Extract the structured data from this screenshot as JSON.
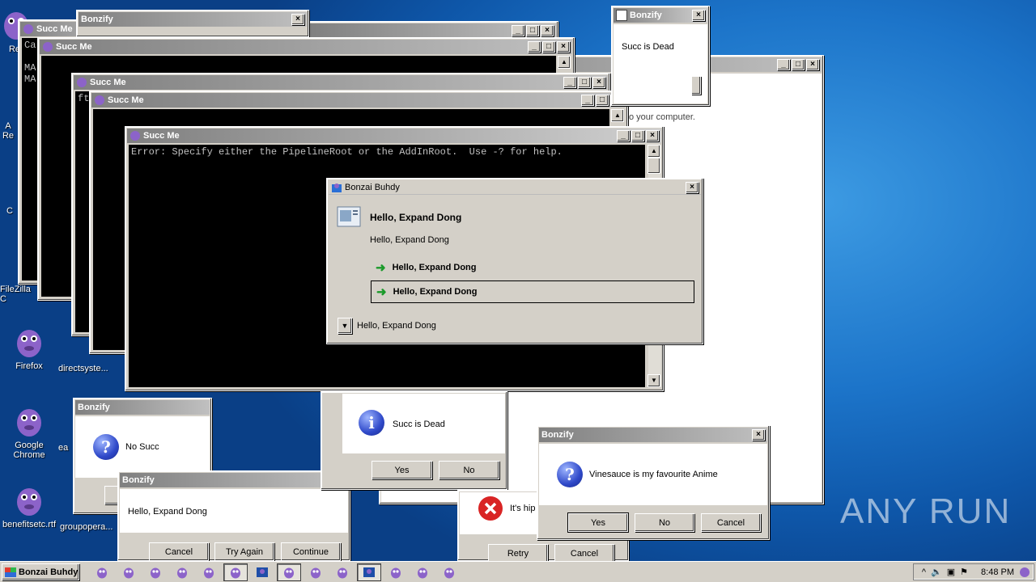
{
  "desktop_icons": [
    {
      "label": "Re",
      "name": "desktop-icon-re-1"
    },
    {
      "label": "A\nRe",
      "name": "desktop-icon-re-2"
    },
    {
      "label": "C",
      "name": "desktop-icon-c"
    },
    {
      "label": "FileZilla C",
      "name": "desktop-icon-filezilla"
    },
    {
      "label": "Firefox",
      "name": "desktop-icon-firefox"
    },
    {
      "label": "directsyste...",
      "name": "desktop-icon-directsystem"
    },
    {
      "label": "Google\nChrome",
      "name": "desktop-icon-chrome"
    },
    {
      "label": "ea",
      "name": "desktop-icon-ea"
    },
    {
      "label": "benefitsetc.rtf",
      "name": "desktop-icon-benefitsetc"
    },
    {
      "label": "groupopera...",
      "name": "desktop-icon-groupopera"
    }
  ],
  "windows": {
    "back_succ_1": {
      "title": "Succ Me",
      "text": "Ca\n\nMA\nMA"
    },
    "back_bonzify_top": {
      "title": "Bonzify"
    },
    "succ_2": {
      "title": "Succ Me"
    },
    "succ_3": {
      "title": "Succ Me",
      "text": "ft"
    },
    "succ_4": {
      "title": "Succ Me"
    },
    "succ_main": {
      "title": "Succ Me",
      "text": "Error: Specify either the PipelineRoot or the AddInRoot.  Use -? for help."
    },
    "bg_installer": {
      "partial_text": "o your computer."
    },
    "bonzify_dead_top": {
      "title": "Bonzify",
      "message": "Succ is Dead"
    },
    "bonzai_dialog": {
      "title": "Bonzai Buhdy",
      "heading": "Hello, Expand Dong",
      "subtext": "Hello, Expand Dong",
      "option1": "Hello, Expand Dong",
      "option2": "Hello, Expand Dong",
      "details": "Hello, Expand Dong"
    },
    "bonzify_nosucc": {
      "title": "Bonzify",
      "message": "No Succ"
    },
    "bonzify_hello": {
      "title": "Bonzify",
      "message": "Hello, Expand Dong",
      "buttons": [
        "Cancel",
        "Try Again",
        "Continue"
      ]
    },
    "info_dead": {
      "message": "Succ is Dead",
      "buttons": [
        "Yes",
        "No"
      ]
    },
    "error_partial": {
      "message": "It's hip",
      "buttons": [
        "Retry",
        "Cancel"
      ]
    },
    "bonzify_anime": {
      "title": "Bonzify",
      "message": "Vinesauce is my favourite Anime",
      "buttons": [
        "Yes",
        "No",
        "Cancel"
      ]
    }
  },
  "taskbar": {
    "start_label": "Bonzai Buhdy",
    "clock": "8:48 PM",
    "item_count": 14
  },
  "watermark": "ANY RUN"
}
